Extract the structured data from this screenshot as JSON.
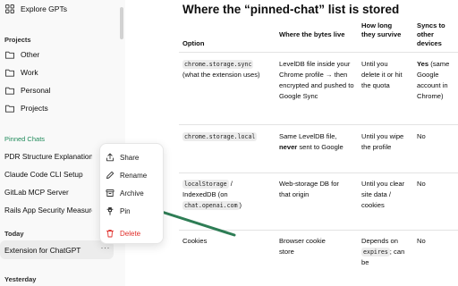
{
  "sidebar": {
    "top_item": {
      "label": "Explore GPTs",
      "icon": "grid-icon"
    },
    "projects_heading": "Projects",
    "projects": [
      {
        "label": "Other",
        "icon": "folder-icon"
      },
      {
        "label": "Work",
        "icon": "folder-icon"
      },
      {
        "label": "Personal",
        "icon": "folder-icon"
      },
      {
        "label": "Projects",
        "icon": "folder-icon"
      }
    ],
    "pinned_heading": "Pinned Chats",
    "pinned": [
      "PDR Structure Explanation",
      "Claude Code CLI Setup",
      "GitLab MCP Server",
      "Rails App Security Measures"
    ],
    "today_heading": "Today",
    "today_active": "Extension for ChatGPT",
    "more_label": "···",
    "yesterday_heading": "Yesterday"
  },
  "menu": {
    "items": [
      {
        "label": "Share",
        "icon": "share-icon"
      },
      {
        "label": "Rename",
        "icon": "pencil-icon"
      },
      {
        "label": "Archive",
        "icon": "archive-icon"
      },
      {
        "label": "Pin",
        "icon": "pin-icon"
      },
      {
        "label": "Delete",
        "icon": "trash-icon"
      }
    ],
    "danger_color": "#e02e2a"
  },
  "article": {
    "heading": "Where the “pinned-chat” list is stored",
    "columns": [
      "Option",
      "Where the bytes live",
      "How long they survive",
      "Syncs to other devices"
    ],
    "rows": [
      {
        "option_code": "chrome.storage.sync",
        "option_note": "(what the extension uses)",
        "where": "LevelDB file inside your Chrome profile → then encrypted and pushed to Google Sync",
        "how_long": "Until you delete it or hit the quota",
        "sync_bold": "Yes",
        "sync_rest": " (same Google account in Chrome)"
      },
      {
        "option_code": "chrome.storage.local",
        "where_pre": "Same LevelDB file, ",
        "where_bold": "never",
        "where_post": " sent to Google",
        "how_long": "Until you wipe the profile",
        "sync": "No"
      },
      {
        "option_code": "localStorage",
        "option_mid": " / IndexedDB (on ",
        "option_code2": "chat.openai.com",
        "option_end": ")",
        "where": "Web-storage DB for that origin",
        "how_long": "Until you clear site data / cookies",
        "sync": "No"
      },
      {
        "option": "Cookies",
        "where": "Browser cookie store",
        "how_long_pre": "Depends on ",
        "how_long_code": "expires",
        "how_long_post": ";",
        "how_long_tail": "can be",
        "sync": "No"
      }
    ]
  },
  "colors": {
    "sidebar_bg": "#f9f9f9",
    "pinned_heading": "#1f8a5a",
    "arrow": "#2e7d55"
  }
}
